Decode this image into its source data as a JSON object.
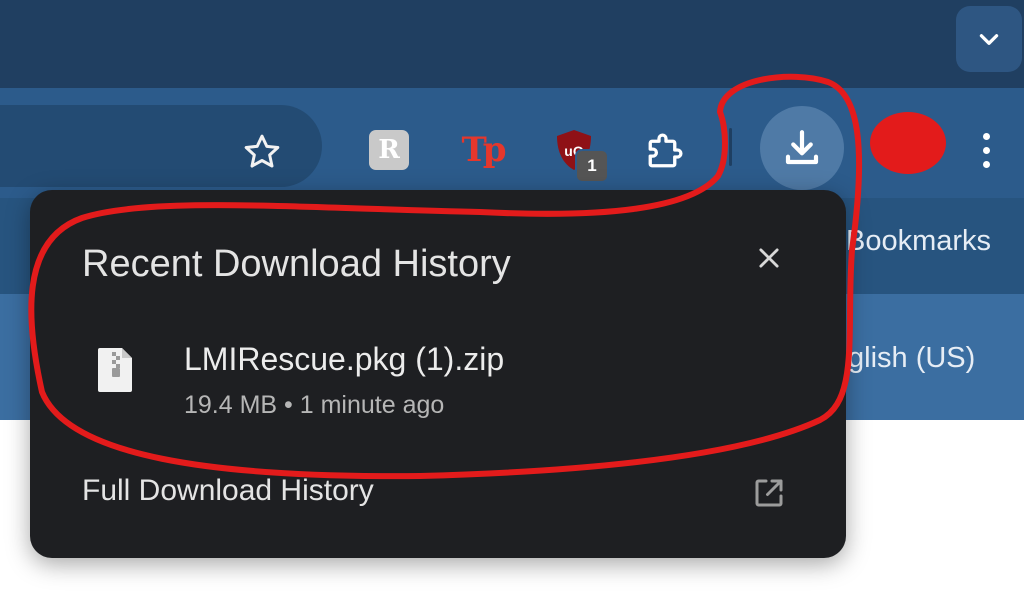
{
  "toolbar": {
    "bookmark_icon": "star-icon",
    "extensions": [
      {
        "name": "r-extension",
        "glyph": "R"
      },
      {
        "name": "tp-extension",
        "glyph": "Tp"
      },
      {
        "name": "ublock-extension",
        "glyph": "uO",
        "badge": "1"
      },
      {
        "name": "extensions-puzzle",
        "glyph": "puzzle-icon"
      }
    ],
    "download_icon": "download-icon",
    "menu_icon": "more-vert-icon",
    "tab_search_icon": "chevron-down-icon"
  },
  "bookmarks_bar": {
    "visible_text": "Bookmarks"
  },
  "page_header": {
    "language_text": "glish (US)"
  },
  "download_popup": {
    "title": "Recent Download History",
    "close_icon": "close-icon",
    "items": [
      {
        "file_name": "LMIRescue.pkg (1).zip",
        "meta": "19.4 MB • 1 minute ago",
        "icon": "zip-file-icon"
      }
    ],
    "footer_link": "Full Download History",
    "footer_icon": "open-in-new-icon"
  },
  "annotation": {
    "color": "#e31b1b"
  },
  "colors": {
    "tabstrip": "#203f61",
    "toolbar": "#2c5b8b",
    "popup_bg": "#1e1f22",
    "accent_red": "#e5372c"
  }
}
